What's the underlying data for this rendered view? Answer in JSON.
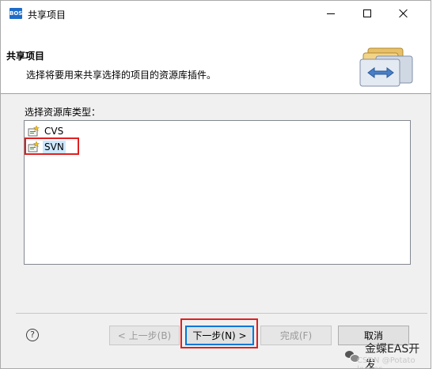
{
  "window": {
    "title": "共享项目",
    "app_icon_text": "BOS"
  },
  "banner": {
    "title": "共享项目",
    "description": "选择将要用来共享选择的项目的资源库插件。"
  },
  "repository": {
    "label": "选择资源库类型：",
    "items": [
      {
        "label": "CVS",
        "selected": false
      },
      {
        "label": "SVN",
        "selected": true
      }
    ]
  },
  "footer": {
    "help_icon": "?",
    "buttons": {
      "back": "< 上一步(B)",
      "next": "下一步(N) >",
      "finish": "完成(F)",
      "cancel": "取消"
    }
  },
  "watermark": {
    "main": "金蝶EAS开发",
    "sub": "CSDN @Potato leaves"
  },
  "colors": {
    "highlight": "#e02020",
    "selection": "#cde8ff",
    "default_button_border": "#0078d7",
    "app_icon": "#1e6cc8"
  }
}
